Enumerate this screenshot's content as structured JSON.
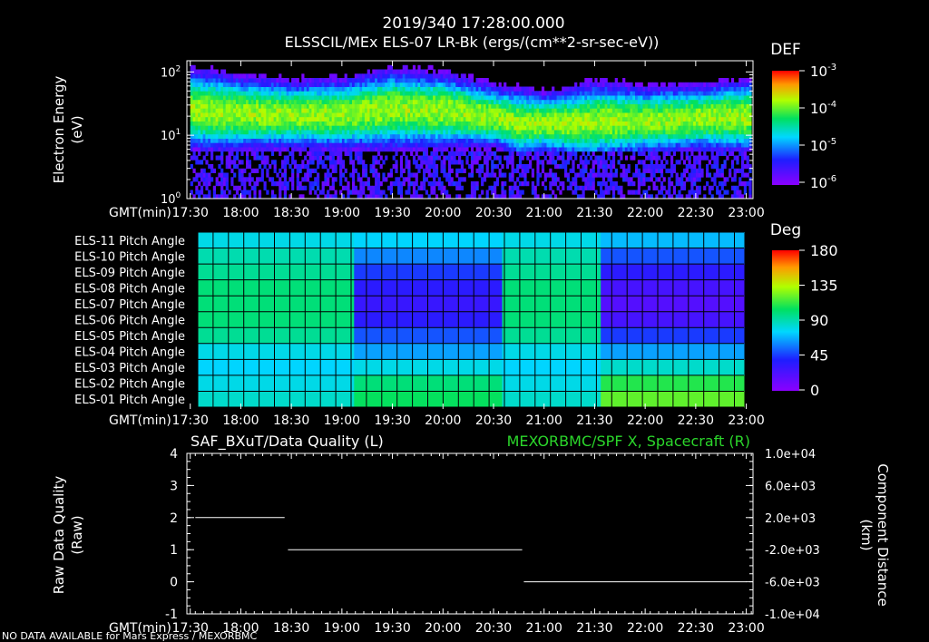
{
  "header": {
    "timestamp": "2019/340 17:28:00.000",
    "title": "ELSSCIL/MEx ELS-07 LR-Bk  (ergs/(cm**2-sr-sec-eV))"
  },
  "footer_note": "NO DATA AVAILABLE for Mars Express / MEXORBMC",
  "colors": {
    "background": "#000000",
    "foreground": "#ffffff",
    "right_axis_label": "#2bd62b"
  },
  "time_axis": {
    "label": "GMT(min)",
    "ticks": [
      "17:30",
      "18:00",
      "18:30",
      "19:00",
      "19:30",
      "20:00",
      "20:30",
      "21:00",
      "21:30",
      "22:00",
      "22:30",
      "23:00"
    ],
    "range": [
      "17:28",
      "23:04"
    ]
  },
  "chart_data": [
    {
      "type": "heatmap",
      "name": "electron-spectrogram",
      "ylabel": "Electron Energy",
      "yunit": "(eV)",
      "yscale": "log",
      "ylim": [
        1,
        150
      ],
      "yticks": [
        {
          "base": "10",
          "exp": "0",
          "value": 1
        },
        {
          "base": "10",
          "exp": "1",
          "value": 10
        },
        {
          "base": "10",
          "exp": "2",
          "value": 100
        }
      ],
      "colorbar": {
        "title": "DEF",
        "scale": "log",
        "range": [
          1e-06,
          0.001
        ],
        "ticks": [
          {
            "base": "10",
            "exp": "-3"
          },
          {
            "base": "10",
            "exp": "-4"
          },
          {
            "base": "10",
            "exp": "-5"
          },
          {
            "base": "10",
            "exp": "-6"
          }
        ]
      },
      "peak_energy_band_eV": {
        "times": [
          "17:30",
          "17:45",
          "18:00",
          "18:30",
          "19:00",
          "19:30",
          "20:00",
          "20:30",
          "20:45",
          "21:00",
          "21:15",
          "21:30",
          "22:00",
          "22:30",
          "23:00"
        ],
        "low": [
          12,
          11,
          11,
          11,
          11,
          12,
          12,
          11,
          8,
          9,
          8,
          8,
          9,
          10,
          10
        ],
        "high": [
          55,
          50,
          45,
          40,
          42,
          55,
          50,
          35,
          30,
          28,
          30,
          35,
          32,
          35,
          40
        ]
      }
    },
    {
      "type": "heatmap",
      "name": "pitch-angle",
      "rows": [
        "ELS-11 Pitch Angle",
        "ELS-10 Pitch Angle",
        "ELS-09 Pitch Angle",
        "ELS-08 Pitch Angle",
        "ELS-07 Pitch Angle",
        "ELS-06 Pitch Angle",
        "ELS-05 Pitch Angle",
        "ELS-04 Pitch Angle",
        "ELS-03 Pitch Angle",
        "ELS-02 Pitch Angle",
        "ELS-01 Pitch Angle"
      ],
      "colorbar": {
        "title": "Deg",
        "range": [
          0,
          180
        ],
        "ticks": [
          "180",
          "135",
          "90",
          "45",
          "0"
        ]
      },
      "segments": [
        {
          "start": "17:30",
          "end": "19:05",
          "values": [
            80,
            90,
            95,
            100,
            100,
            100,
            95,
            80,
            75,
            80,
            85
          ]
        },
        {
          "start": "19:05",
          "end": "20:35",
          "values": [
            75,
            60,
            45,
            35,
            30,
            35,
            50,
            65,
            80,
            100,
            105
          ]
        },
        {
          "start": "20:35",
          "end": "21:35",
          "values": [
            80,
            90,
            95,
            100,
            100,
            100,
            95,
            80,
            75,
            80,
            85
          ]
        },
        {
          "start": "21:35",
          "end": "23:02",
          "values": [
            70,
            50,
            35,
            25,
            20,
            25,
            45,
            65,
            85,
            110,
            120
          ]
        }
      ]
    },
    {
      "type": "line",
      "name": "data-quality",
      "title_left": "SAF_BXuT/Data Quality (L)",
      "title_right": "MEXORBMC/SPF X, Spacecraft (R)",
      "ylabel": "Raw Data Quality",
      "yunit": "(Raw)",
      "ylim": [
        -1,
        4
      ],
      "yticks": [
        "-1",
        "0",
        "1",
        "2",
        "3",
        "4"
      ],
      "right_ylabel": "Component Distance",
      "right_yunit": "(km)",
      "right_ylim": [
        -10000,
        10000
      ],
      "right_yticks": [
        "1.0e+04",
        "6.0e+03",
        "2.0e+03",
        "-2.0e+03",
        "-6.0e+03",
        "-1.0e+04"
      ],
      "series": [
        {
          "start": "17:33",
          "end": "18:26",
          "value": 2
        },
        {
          "start": "18:28",
          "end": "20:47",
          "value": 1
        },
        {
          "start": "20:48",
          "end": "23:00",
          "value": 0
        }
      ]
    }
  ]
}
